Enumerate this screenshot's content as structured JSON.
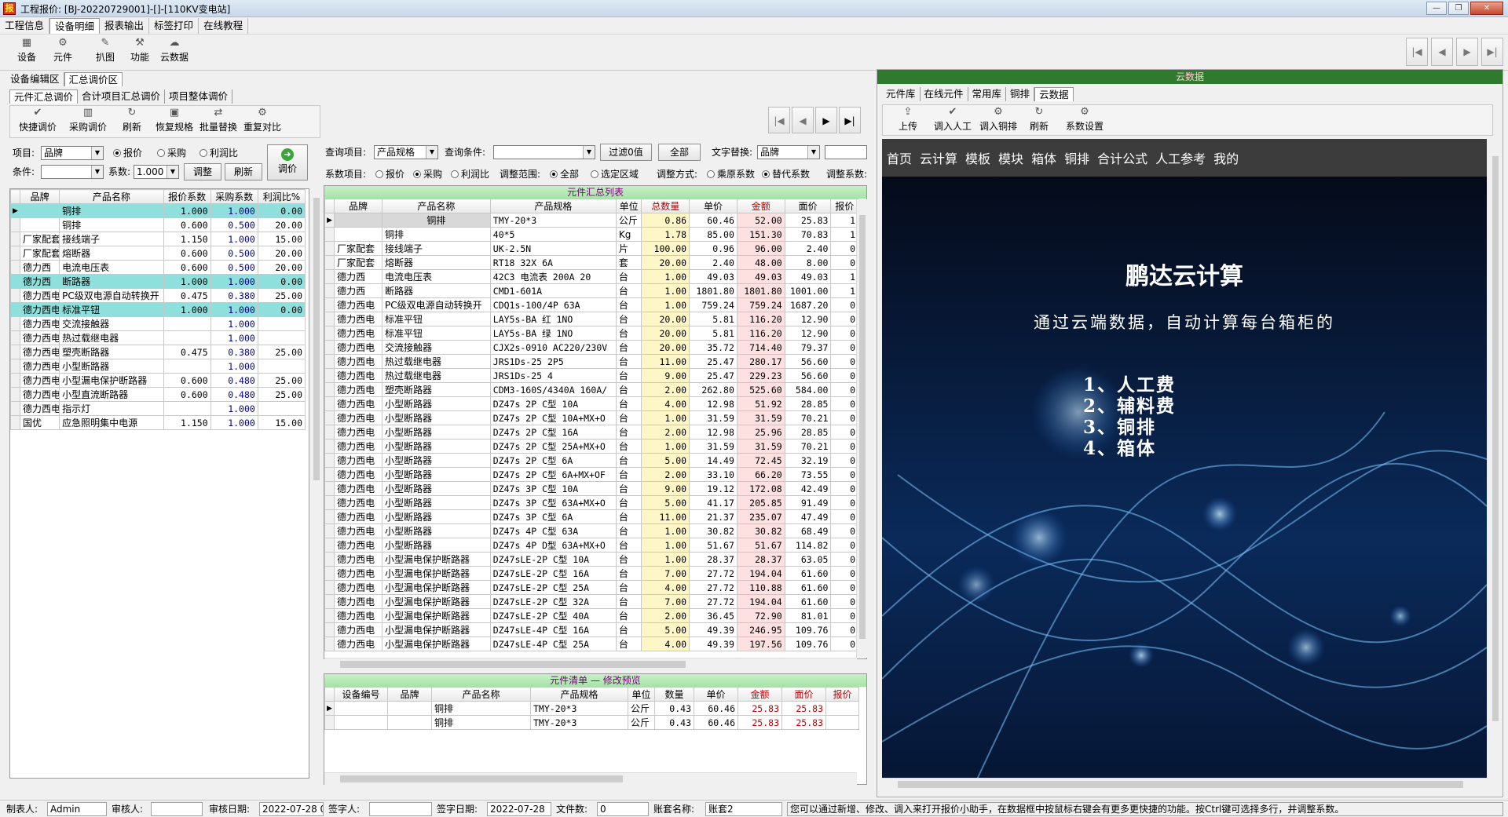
{
  "window": {
    "title": "工程报价: [BJ-20220729001]-[]-[110KV变电站]",
    "icon": "app-icon"
  },
  "menu": [
    "工程信息",
    "设备明细",
    "报表输出",
    "标签打印",
    "在线教程"
  ],
  "menu_active": 1,
  "toolbar": [
    {
      "label": "设备",
      "icon": "device-icon"
    },
    {
      "label": "元件",
      "icon": "component-icon"
    },
    {
      "label": "扒图",
      "icon": "capture-icon"
    },
    {
      "label": "功能",
      "icon": "function-icon"
    },
    {
      "label": "云数据",
      "icon": "cloud-icon"
    }
  ],
  "nav_buttons": [
    "|◀",
    "◀",
    "▶",
    "▶|"
  ],
  "area_tabs": [
    "设备编辑区",
    "汇总调价区"
  ],
  "sub_tabs": [
    "元件汇总调价",
    "合计项目汇总调价",
    "项目整体调价"
  ],
  "left_toolbar": [
    "快捷调价",
    "采购调价",
    "刷新",
    "恢复规格",
    "批量替换",
    "重复对比"
  ],
  "left_controls": {
    "item_label": "项目:",
    "item_value": "品牌",
    "radio_quote": "报价",
    "radio_purchase": "采购",
    "radio_profit": "利润比",
    "cond_label": "条件:",
    "coef_label": "系数:",
    "coef_value": "1.000",
    "adjust_btn": "调整",
    "refresh_btn": "刷新",
    "price_btn": "调价"
  },
  "left_grid": {
    "headers": [
      "品牌",
      "产品名称",
      "报价系数",
      "采购系数",
      "利润比%"
    ],
    "rows": [
      {
        "brand": "",
        "name": "铜排",
        "quote": "1.000",
        "purchase": "1.000",
        "profit": "0.00",
        "hl": true,
        "cur": true
      },
      {
        "brand": "",
        "name": "铜排",
        "quote": "0.600",
        "purchase": "0.500",
        "profit": "20.00"
      },
      {
        "brand": "厂家配套",
        "name": "接线端子",
        "quote": "1.150",
        "purchase": "1.000",
        "profit": "15.00"
      },
      {
        "brand": "厂家配套",
        "name": "熔断器",
        "quote": "0.600",
        "purchase": "0.500",
        "profit": "20.00"
      },
      {
        "brand": "德力西",
        "name": "电流电压表",
        "quote": "0.600",
        "purchase": "0.500",
        "profit": "20.00"
      },
      {
        "brand": "德力西",
        "name": "断路器",
        "quote": "1.000",
        "purchase": "1.000",
        "profit": "0.00",
        "hl": true
      },
      {
        "brand": "德力西电",
        "name": "PC级双电源自动转换开",
        "quote": "0.475",
        "purchase": "0.380",
        "profit": "25.00"
      },
      {
        "brand": "德力西电",
        "name": "标准平钮",
        "quote": "1.000",
        "purchase": "1.000",
        "profit": "0.00",
        "hl": true
      },
      {
        "brand": "德力西电",
        "name": "交流接触器",
        "quote": "",
        "purchase": "1.000",
        "profit": ""
      },
      {
        "brand": "德力西电",
        "name": "热过载继电器",
        "quote": "",
        "purchase": "1.000",
        "profit": ""
      },
      {
        "brand": "德力西电",
        "name": "塑壳断路器",
        "quote": "0.475",
        "purchase": "0.380",
        "profit": "25.00"
      },
      {
        "brand": "德力西电",
        "name": "小型断路器",
        "quote": "",
        "purchase": "1.000",
        "profit": ""
      },
      {
        "brand": "德力西电",
        "name": "小型漏电保护断路器",
        "quote": "0.600",
        "purchase": "0.480",
        "profit": "25.00"
      },
      {
        "brand": "德力西电",
        "name": "小型直流断路器",
        "quote": "0.600",
        "purchase": "0.480",
        "profit": "25.00"
      },
      {
        "brand": "德力西电",
        "name": "指示灯",
        "quote": "",
        "purchase": "1.000",
        "profit": ""
      },
      {
        "brand": "国优",
        "name": "应急照明集中电源",
        "quote": "1.150",
        "purchase": "1.000",
        "profit": "15.00"
      }
    ]
  },
  "mid_controls": {
    "query_item_label": "查询项目:",
    "query_item_value": "产品规格",
    "query_cond_label": "查询条件:",
    "filter_btn": "过滤0值",
    "all_btn": "全部",
    "text_replace_label": "文字替换:",
    "text_replace_value": "品牌",
    "coef_item_label": "系数项目:",
    "r_quote": "报价",
    "r_purchase": "采购",
    "r_profit": "利润比",
    "range_label": "调整范围:",
    "r_all": "全部",
    "r_selected": "选定区域",
    "mode_label": "调整方式:",
    "r_multiply": "乘原系数",
    "r_replace": "替代系数",
    "adj_coef_label": "调整系数:"
  },
  "mid_grid": {
    "caption": "元件汇总列表",
    "headers": [
      "品牌",
      "产品名称",
      "产品规格",
      "单位",
      "总数量",
      "单价",
      "金额",
      "面价",
      "报价"
    ],
    "rows": [
      [
        "",
        "铜排",
        "TMY-20*3",
        "公斤",
        "0.86",
        "60.46",
        "52.00",
        "25.83",
        "1"
      ],
      [
        "",
        "铜排",
        "40*5",
        "Kg",
        "1.78",
        "85.00",
        "151.30",
        "70.83",
        "1"
      ],
      [
        "厂家配套",
        "接线端子",
        "UK-2.5N",
        "片",
        "100.00",
        "0.96",
        "96.00",
        "2.40",
        "0"
      ],
      [
        "厂家配套",
        "熔断器",
        "RT18 32X 6A",
        "套",
        "20.00",
        "2.40",
        "48.00",
        "8.00",
        "0"
      ],
      [
        "德力西",
        "电流电压表",
        "42C3 电流表 200A 20",
        "台",
        "1.00",
        "49.03",
        "49.03",
        "49.03",
        "1"
      ],
      [
        "德力西",
        "断路器",
        "CMD1-601A",
        "台",
        "1.00",
        "1801.80",
        "1801.80",
        "1001.00",
        "1"
      ],
      [
        "德力西电",
        "PC级双电源自动转换开",
        "CDQ1s-100/4P 63A",
        "台",
        "1.00",
        "759.24",
        "759.24",
        "1687.20",
        "0"
      ],
      [
        "德力西电",
        "标准平钮",
        "LAY5s-BA 红 1NO",
        "台",
        "20.00",
        "5.81",
        "116.20",
        "12.90",
        "0"
      ],
      [
        "德力西电",
        "标准平钮",
        "LAY5s-BA 绿 1NO",
        "台",
        "20.00",
        "5.81",
        "116.20",
        "12.90",
        "0"
      ],
      [
        "德力西电",
        "交流接触器",
        "CJX2s-0910 AC220/230V",
        "台",
        "20.00",
        "35.72",
        "714.40",
        "79.37",
        "0"
      ],
      [
        "德力西电",
        "热过载继电器",
        "JRS1Ds-25 2P5",
        "台",
        "11.00",
        "25.47",
        "280.17",
        "56.60",
        "0"
      ],
      [
        "德力西电",
        "热过载继电器",
        "JRS1Ds-25 4",
        "台",
        "9.00",
        "25.47",
        "229.23",
        "56.60",
        "0"
      ],
      [
        "德力西电",
        "塑壳断路器",
        "CDM3-160S/4340A 160A/",
        "台",
        "2.00",
        "262.80",
        "525.60",
        "584.00",
        "0"
      ],
      [
        "德力西电",
        "小型断路器",
        "DZ47s 2P C型 10A",
        "台",
        "4.00",
        "12.98",
        "51.92",
        "28.85",
        "0"
      ],
      [
        "德力西电",
        "小型断路器",
        "DZ47s 2P C型 10A+MX+O",
        "台",
        "1.00",
        "31.59",
        "31.59",
        "70.21",
        "0"
      ],
      [
        "德力西电",
        "小型断路器",
        "DZ47s 2P C型 16A",
        "台",
        "2.00",
        "12.98",
        "25.96",
        "28.85",
        "0"
      ],
      [
        "德力西电",
        "小型断路器",
        "DZ47s 2P C型 25A+MX+O",
        "台",
        "1.00",
        "31.59",
        "31.59",
        "70.21",
        "0"
      ],
      [
        "德力西电",
        "小型断路器",
        "DZ47s 2P C型 6A",
        "台",
        "5.00",
        "14.49",
        "72.45",
        "32.19",
        "0"
      ],
      [
        "德力西电",
        "小型断路器",
        "DZ47s 2P C型 6A+MX+OF",
        "台",
        "2.00",
        "33.10",
        "66.20",
        "73.55",
        "0"
      ],
      [
        "德力西电",
        "小型断路器",
        "DZ47s 3P C型 10A",
        "台",
        "9.00",
        "19.12",
        "172.08",
        "42.49",
        "0"
      ],
      [
        "德力西电",
        "小型断路器",
        "DZ47s 3P C型 63A+MX+O",
        "台",
        "5.00",
        "41.17",
        "205.85",
        "91.49",
        "0"
      ],
      [
        "德力西电",
        "小型断路器",
        "DZ47s 3P C型 6A",
        "台",
        "11.00",
        "21.37",
        "235.07",
        "47.49",
        "0"
      ],
      [
        "德力西电",
        "小型断路器",
        "DZ47s 4P C型 63A",
        "台",
        "1.00",
        "30.82",
        "30.82",
        "68.49",
        "0"
      ],
      [
        "德力西电",
        "小型断路器",
        "DZ47s 4P D型 63A+MX+O",
        "台",
        "1.00",
        "51.67",
        "51.67",
        "114.82",
        "0"
      ],
      [
        "德力西电",
        "小型漏电保护断路器",
        "DZ47sLE-2P C型 10A",
        "台",
        "1.00",
        "28.37",
        "28.37",
        "63.05",
        "0"
      ],
      [
        "德力西电",
        "小型漏电保护断路器",
        "DZ47sLE-2P C型 16A",
        "台",
        "7.00",
        "27.72",
        "194.04",
        "61.60",
        "0"
      ],
      [
        "德力西电",
        "小型漏电保护断路器",
        "DZ47sLE-2P C型 25A",
        "台",
        "4.00",
        "27.72",
        "110.88",
        "61.60",
        "0"
      ],
      [
        "德力西电",
        "小型漏电保护断路器",
        "DZ47sLE-2P C型 32A",
        "台",
        "7.00",
        "27.72",
        "194.04",
        "61.60",
        "0"
      ],
      [
        "德力西电",
        "小型漏电保护断路器",
        "DZ47sLE-2P C型 40A",
        "台",
        "2.00",
        "36.45",
        "72.90",
        "81.01",
        "0"
      ],
      [
        "德力西电",
        "小型漏电保护断路器",
        "DZ47sLE-4P C型 16A",
        "台",
        "5.00",
        "49.39",
        "246.95",
        "109.76",
        "0"
      ],
      [
        "德力西电",
        "小型漏电保护断路器",
        "DZ47sLE-4P C型 25A",
        "台",
        "4.00",
        "49.39",
        "197.56",
        "109.76",
        "0"
      ]
    ]
  },
  "bottom_grid": {
    "caption": "元件清单 — 修改预览",
    "headers": [
      "设备编号",
      "品牌",
      "产品名称",
      "产品规格",
      "单位",
      "数量",
      "单价",
      "金额",
      "面价",
      "报价"
    ],
    "rows": [
      [
        "",
        "",
        "铜排",
        "TMY-20*3",
        "公斤",
        "0.43",
        "60.46",
        "25.83",
        "25.83",
        ""
      ],
      [
        "",
        "",
        "铜排",
        "TMY-20*3",
        "公斤",
        "0.43",
        "60.46",
        "25.83",
        "25.83",
        ""
      ]
    ]
  },
  "right_panel": {
    "header": "云数据",
    "tabs": [
      "元件库",
      "在线元件",
      "常用库",
      "铜排",
      "云数据"
    ],
    "active_tab": 4,
    "toolbar": [
      "上传",
      "调入人工",
      "调入铜排",
      "刷新",
      "系数设置"
    ],
    "web_nav": [
      "首页",
      "云计算",
      "模板",
      "模块",
      "箱体",
      "铜排",
      "合计公式",
      "人工参考",
      "我的"
    ],
    "banner_title": "鹏达云计算",
    "banner_subtitle": "通过云端数据，自动计算每台箱柜的",
    "banner_items": [
      "1、人工费",
      "2、辅料费",
      "3、铜排",
      "4、箱体"
    ]
  },
  "status": {
    "maker_label": "制表人:",
    "maker": "Admin",
    "reviewer_label": "审核人:",
    "reviewer": "",
    "review_date_label": "审核日期:",
    "review_date": "2022-07-28 0",
    "signer_label": "签字人:",
    "signer": "",
    "sign_date_label": "签字日期:",
    "sign_date": "2022-07-28",
    "files_label": "文件数:",
    "files": "0",
    "account_label": "账套名称:",
    "account": "账套2",
    "hint": "您可以通过新增、修改、调入来打开报价小助手，在数据框中按鼠标右键会有更多更快捷的功能。按Ctrl键可选择多行，并调整系数。"
  },
  "colors": {
    "highlight_row": "#8fe0dd",
    "banner_bg": "#04132b",
    "caption_green": "#a8e2a8"
  }
}
